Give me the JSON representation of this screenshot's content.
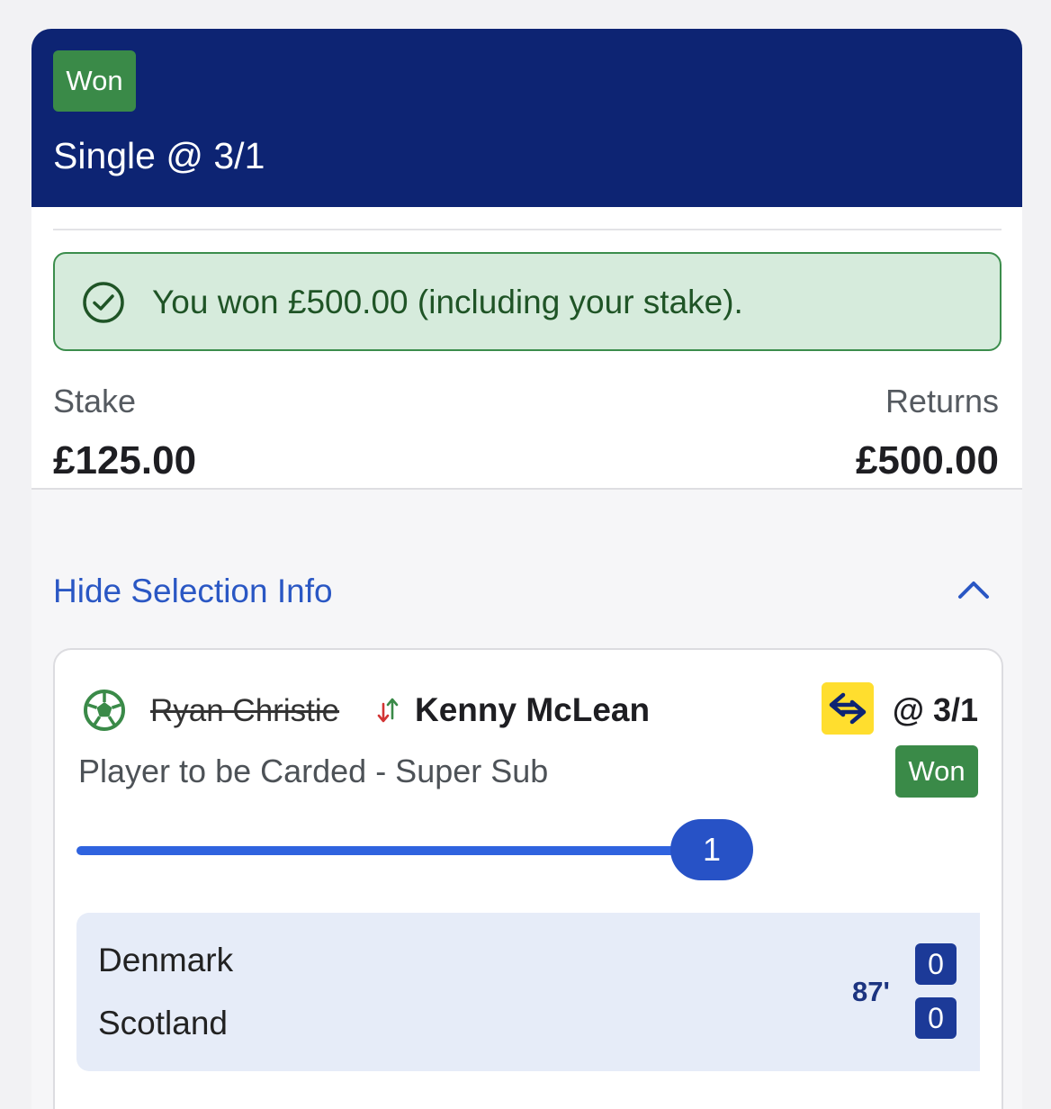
{
  "header": {
    "status_badge": "Won",
    "title": "Single @ 3/1"
  },
  "alert": {
    "message": "You won £500.00 (including your stake)."
  },
  "summary": {
    "stake_label": "Stake",
    "stake_value": "£125.00",
    "returns_label": "Returns",
    "returns_value": "£500.00"
  },
  "selection_toggle": {
    "label": "Hide Selection Info"
  },
  "selection": {
    "original_player": "Ryan Christie",
    "substitute_player": "Kenny McLean",
    "odds": "@ 3/1",
    "market": "Player to be Carded - Super Sub",
    "status_badge": "Won",
    "progress_count": "1",
    "progress_fraction": 1.0
  },
  "match": {
    "home_team": "Denmark",
    "away_team": "Scotland",
    "minute": "87'",
    "home_score": "0",
    "away_score": "0"
  },
  "colors": {
    "header_bg": "#0d2473",
    "won_green": "#3a8a48",
    "link_blue": "#2a57c4",
    "alert_bg": "#d6ebdc",
    "super_sub_yellow": "#ffde2e"
  },
  "icons": {
    "alert": "check-circle-icon",
    "toggle": "chevron-up-icon",
    "sport": "football-icon",
    "sub": "swap-arrows-icon",
    "super_sub": "super-sub-icon"
  }
}
